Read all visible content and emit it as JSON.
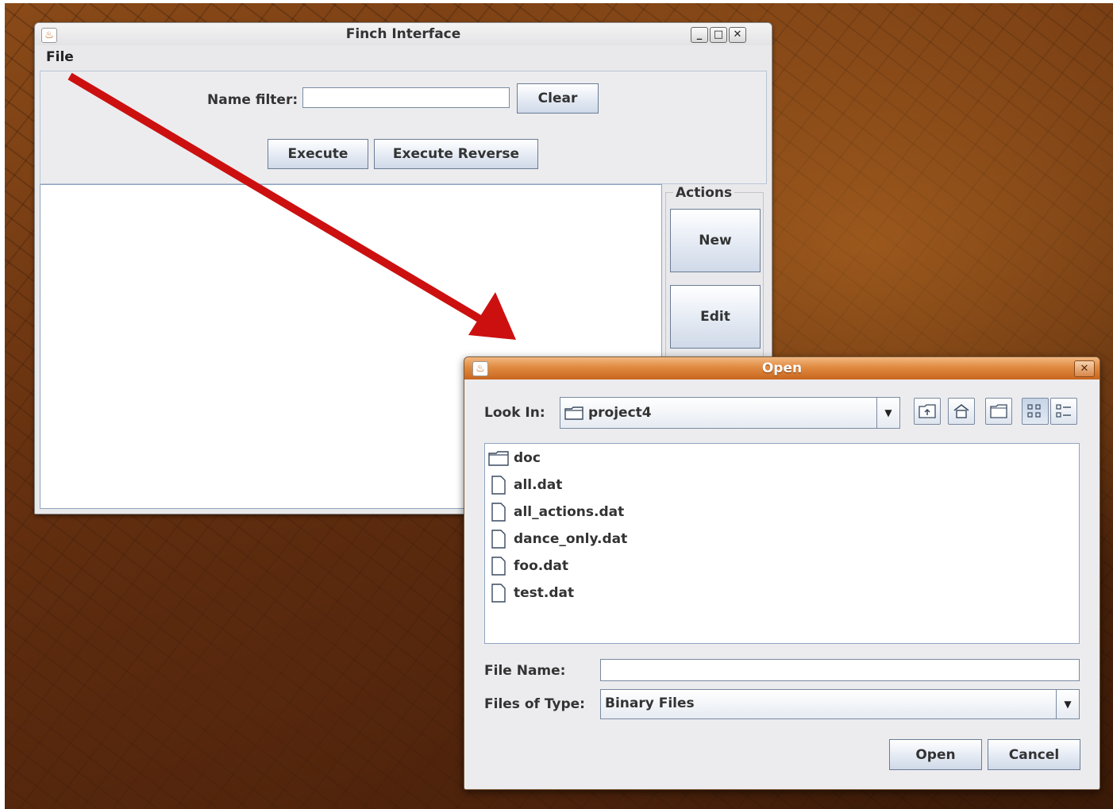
{
  "main_window": {
    "title": "Finch Interface",
    "menu": {
      "file": "File"
    },
    "name_filter_label": "Name filter:",
    "name_filter_value": "",
    "clear_button": "Clear",
    "execute_button": "Execute",
    "execute_reverse_button": "Execute Reverse",
    "actions_group_title": "Actions",
    "new_button": "New",
    "edit_button": "Edit"
  },
  "open_dialog": {
    "title": "Open",
    "look_in_label": "Look In:",
    "look_in_value": "project4",
    "files": [
      {
        "name": "doc",
        "icon": "folder-icon"
      },
      {
        "name": "all.dat",
        "icon": "file-icon"
      },
      {
        "name": "all_actions.dat",
        "icon": "file-icon"
      },
      {
        "name": "dance_only.dat",
        "icon": "file-icon"
      },
      {
        "name": "foo.dat",
        "icon": "file-icon"
      },
      {
        "name": "test.dat",
        "icon": "file-icon"
      }
    ],
    "file_name_label": "File Name:",
    "file_name_value": "",
    "files_of_type_label": "Files of Type:",
    "files_of_type_value": "Binary Files",
    "open_button": "Open",
    "cancel_button": "Cancel"
  },
  "colors": {
    "arrow": "#cc1010",
    "dialog_titlebar": "#e08a40",
    "button_border": "#6a7c94"
  }
}
